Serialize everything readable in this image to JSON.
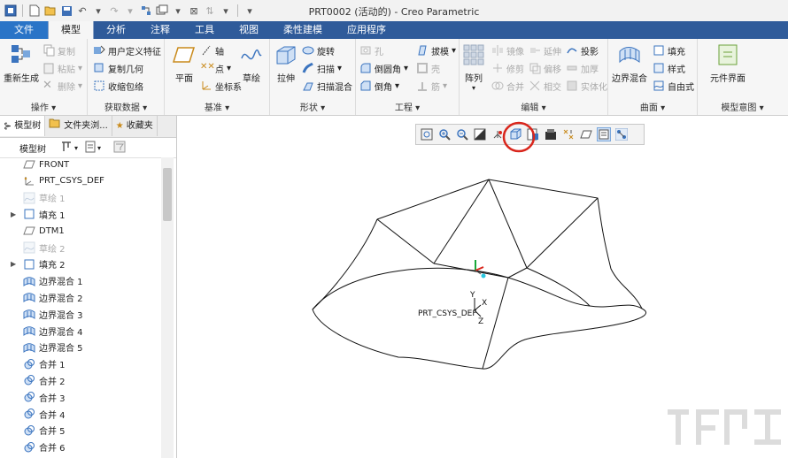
{
  "window": {
    "title": "PRT0002 (活动的) - Creo Parametric"
  },
  "tabs": [
    {
      "label": "文件"
    },
    {
      "label": "模型"
    },
    {
      "label": "分析"
    },
    {
      "label": "注释"
    },
    {
      "label": "工具"
    },
    {
      "label": "视图"
    },
    {
      "label": "柔性建模"
    },
    {
      "label": "应用程序"
    }
  ],
  "ribbon": {
    "ops": {
      "label": "操作",
      "regen": "重新生成",
      "copy": "复制",
      "paste": "粘贴",
      "delete": "删除"
    },
    "getdata": {
      "label": "获取数据",
      "udf": "用户定义特征",
      "copygeom": "复制几何",
      "shrinkwrap": "收缩包络"
    },
    "datum": {
      "label": "基准",
      "plane": "平面",
      "axis": "轴",
      "point": "点",
      "csys": "坐标系",
      "sketch": "草绘"
    },
    "shapes": {
      "label": "形状",
      "extrude": "拉伸",
      "revolve": "旋转",
      "sweep": "扫描",
      "sweepblend": "扫描混合"
    },
    "eng": {
      "label": "工程",
      "hole": "孔",
      "draft": "拔模",
      "round": "倒圆角",
      "shell": "壳",
      "chamfer": "倒角",
      "rib": "筋"
    },
    "edit": {
      "label": "编辑",
      "pattern": "阵列",
      "mirror": "镜像",
      "extend": "延伸",
      "project": "投影",
      "trim": "修剪",
      "offset": "偏移",
      "thicken": "加厚",
      "merge": "合并",
      "intersect": "相交",
      "solidify": "实体化"
    },
    "surfaces": {
      "label": "曲面",
      "boundary": "边界混合",
      "fill": "填充",
      "style": "样式",
      "freestyle": "自由式"
    },
    "intent": {
      "label": "模型意图",
      "component": "元件界面"
    }
  },
  "panel": {
    "tabs": [
      {
        "label": "模型树"
      },
      {
        "label": "文件夹浏..."
      },
      {
        "label": "收藏夹"
      }
    ],
    "tree_header": "模型树",
    "items": [
      {
        "label": "FRONT",
        "icon": "datum-plane-icon",
        "expandable": false,
        "dim": false
      },
      {
        "label": "PRT_CSYS_DEF",
        "icon": "csys-icon",
        "expandable": false,
        "dim": false
      },
      {
        "label": "草绘 1",
        "icon": "sketch-icon",
        "expandable": false,
        "dim": true
      },
      {
        "label": "填充 1",
        "icon": "fill-icon",
        "expandable": true,
        "dim": false
      },
      {
        "label": "DTM1",
        "icon": "datum-plane-icon",
        "expandable": false,
        "dim": false
      },
      {
        "label": "草绘 2",
        "icon": "sketch-icon",
        "expandable": false,
        "dim": true
      },
      {
        "label": "填充 2",
        "icon": "fill-icon",
        "expandable": true,
        "dim": false
      },
      {
        "label": "边界混合 1",
        "icon": "boundary-blend-icon",
        "expandable": false,
        "dim": false
      },
      {
        "label": "边界混合 2",
        "icon": "boundary-blend-icon",
        "expandable": false,
        "dim": false
      },
      {
        "label": "边界混合 3",
        "icon": "boundary-blend-icon",
        "expandable": false,
        "dim": false
      },
      {
        "label": "边界混合 4",
        "icon": "boundary-blend-icon",
        "expandable": false,
        "dim": false
      },
      {
        "label": "边界混合 5",
        "icon": "boundary-blend-icon",
        "expandable": false,
        "dim": false
      },
      {
        "label": "合并 1",
        "icon": "merge-icon",
        "expandable": false,
        "dim": false
      },
      {
        "label": "合并 2",
        "icon": "merge-icon",
        "expandable": false,
        "dim": false
      },
      {
        "label": "合并 3",
        "icon": "merge-icon",
        "expandable": false,
        "dim": false
      },
      {
        "label": "合并 4",
        "icon": "merge-icon",
        "expandable": false,
        "dim": false
      },
      {
        "label": "合并 5",
        "icon": "merge-icon",
        "expandable": false,
        "dim": false
      },
      {
        "label": "合并 6",
        "icon": "merge-icon",
        "expandable": false,
        "dim": false
      }
    ]
  },
  "viewport": {
    "csys_label": "PRT_CSYS_DEF",
    "axes": {
      "x": "X",
      "y": "Y",
      "z": "Z"
    }
  },
  "colors": {
    "tabbar": "#2f5b9a",
    "highlight": "#d9261c"
  }
}
